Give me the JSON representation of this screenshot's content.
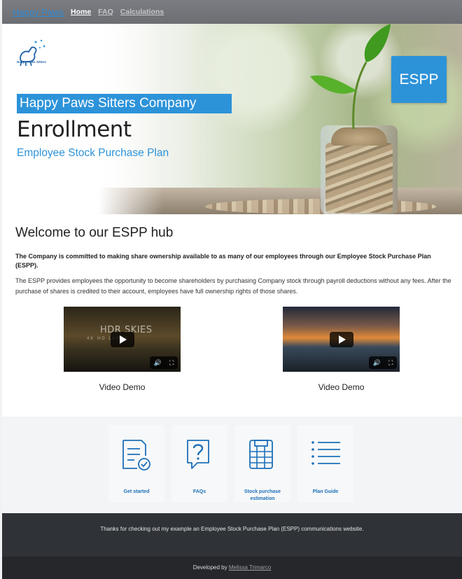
{
  "nav": {
    "brand": "Happy Paws",
    "links": [
      "Home",
      "FAQ",
      "Calculations"
    ]
  },
  "hero": {
    "logo_text": "Happy Paws Sitters",
    "company": "Happy Paws Sitters Company",
    "title": "Enrollment",
    "subtitle": "Employee Stock Purchase Plan",
    "badge": "ESPP"
  },
  "welcome": {
    "title": "Welcome to our ESPP hub",
    "bold_text": "The Company is committed to making share ownership available to as many of our employees through our Employee Stock Purchase Plan (ESPP).",
    "body_text": "The ESPP provides employees the opportunity to become shareholders by purchasing Company stock through payroll deductions without any fees. After the purchase of shares is credited to their account, employees have full ownership rights of those shares."
  },
  "videos": [
    {
      "overlay_title": "HDR SKIES",
      "overlay_sub": "4K HD   LAPSE",
      "label": "Video Demo"
    },
    {
      "overlay_title": "",
      "overlay_sub": "",
      "label": "Video Demo"
    }
  ],
  "cards": [
    {
      "label": "Get started",
      "icon": "document-check-icon"
    },
    {
      "label": "FAQs",
      "icon": "question-bubble-icon"
    },
    {
      "label": "Stock purchase estimation",
      "icon": "calculator-icon"
    },
    {
      "label": "Plan Guide",
      "icon": "list-icon"
    }
  ],
  "footer": {
    "message": "Thanks for checking out my example an Employee Stock Purchase Plan (ESPP) communications website.",
    "developed_by": "Developed by",
    "author": "Melissa Trimarco"
  },
  "colors": {
    "accent": "#2d93d9",
    "nav_bg": "#6c6e73",
    "footer_bg": "#2f3236"
  }
}
